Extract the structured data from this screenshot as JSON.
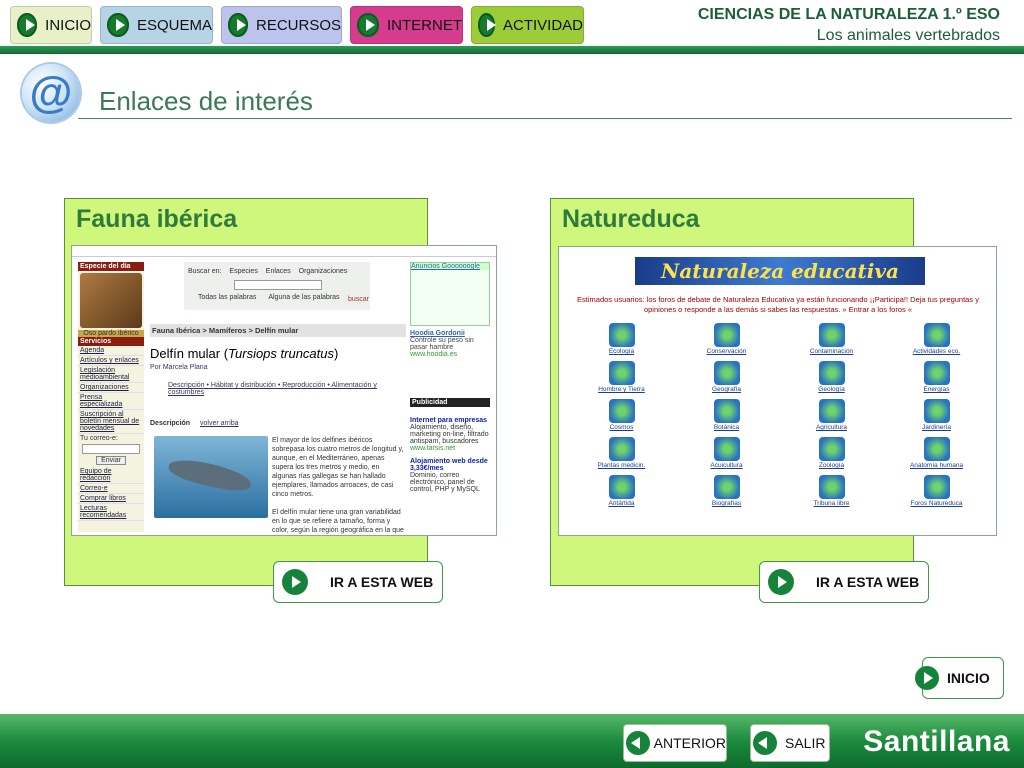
{
  "nav": {
    "buttons": [
      {
        "label": "INICIO",
        "color": "#e8f0c8"
      },
      {
        "label": "ESQUEMA",
        "color": "#b7d3e6"
      },
      {
        "label": "RECURSOS",
        "color": "#bcc4ee"
      },
      {
        "label": "INTERNET",
        "color": "#d53c8e"
      },
      {
        "label": "ACTIVIDAD",
        "color": "#9ccd39"
      }
    ]
  },
  "course": {
    "title": "CIENCIAS DE LA NATURALEZA 1.º ESO",
    "subtitle": "Los animales vertebrados"
  },
  "page": {
    "icon": "at-sign-icon",
    "title": "Enlaces de interés"
  },
  "panels": [
    {
      "title": "Fauna ibérica",
      "button_label": "IR A ESTA WEB",
      "screenshot": {
        "especie_header": "Especie del día",
        "especie_caption": "Oso pardo ibérico",
        "servicios_header": "Servicios",
        "links": [
          "Agenda",
          "Artículos y enlaces",
          "Legislación medioambiental",
          "Organizaciones",
          "Prensa especializada",
          "Suscripción al boletín mensual de novedades"
        ],
        "email_label": "Tu correo-e:",
        "send_label": "Enviar",
        "links2": [
          "Equipo de redacción",
          "Correo-e",
          "Comprar libros",
          "Lecturas recomendadas"
        ],
        "search_label": "Buscar en:",
        "search_opts": [
          "Especies",
          "Enlaces",
          "Organizaciones"
        ],
        "radio_opts": [
          "Todas las palabras",
          "Alguna de las palabras"
        ],
        "search_btn": "buscar",
        "breadcrumb": "Fauna Ibérica > Mamíferos > Delfín mular",
        "species": "Delfín mular (",
        "species_latin": "Tursiops truncatus",
        "species_close": ")",
        "author": "Por Marcela Plana",
        "sections": "Descripción • Hábitat y distribución • Reproducción • Alimentación y costumbres",
        "desc_label": "Descripción",
        "back_link": "volver arriba",
        "para1": "El mayor de los delfines ibéricos sobrepasa los cuatro metros de longitud y, aunque, en el Mediterráneo, apenas supera los tres metros y medio, en algunas rías gallegas se han hallado ejemplares, llamados arroaces, de casi cinco metros.",
        "para2": "El delfín mular tiene una gran variabilidad en lo que se refiere a tamaño, forma y color, según la región geográfica en la que vive; de hecho, es probable que incluya",
        "ad_header": "Anuncios Goooooogle",
        "ad_title": "Hoodia Gordonii",
        "ad_text": "Controle su peso sin pasar hambre",
        "ad_url": "www.hoodia.es",
        "pub_header": "Publicidad",
        "pub_title": "Internet para empresas",
        "pub_text": "Alojamiento, diseño, marketing on-line, filtrado antispam, buscadores",
        "pub_url": "www.tarsis.net",
        "pub_title2": "Alojamiento web desde 3,33€/mes",
        "pub_text2": "Dominio, correo electrónico, panel de control, PHP y MySQL"
      }
    },
    {
      "title": "Natureduca",
      "button_label": "IR A ESTA WEB",
      "screenshot": {
        "banner": "Naturaleza educativa",
        "notice": "Estimados usuarios: los foros de debate de Naturaleza Educativa ya están funcionando ¡¡Participa!! Deja tus preguntas y opiniones o responde a las demás si sabes las respuestas. » Entrar a los foros «",
        "items": [
          "Ecología",
          "Conservación",
          "Contaminación",
          "Actividades eco.",
          "Hombre y Tierra",
          "Geografía",
          "Geología",
          "Energías",
          "Cosmos",
          "Botánica",
          "Agricultura",
          "Jardinería",
          "Plantas medicin.",
          "Acuicultura",
          "Zoología",
          "Anatomía humana",
          "Antártida",
          "Biografías",
          "Tribuna libre",
          "Foros Natureduca"
        ]
      }
    }
  ],
  "footer": {
    "inicio": "INICIO",
    "anterior": "ANTERIOR",
    "salir": "SALIR",
    "brand": "Santillana"
  }
}
